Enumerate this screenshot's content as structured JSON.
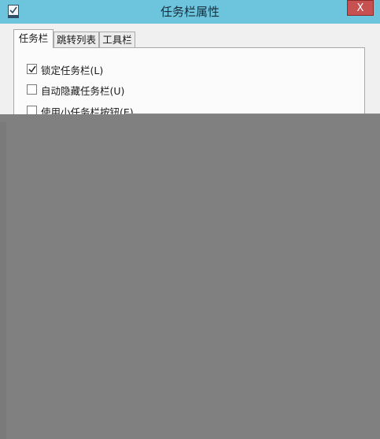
{
  "window": {
    "title": "任务栏属性",
    "close_glyph": "X"
  },
  "tabs": [
    {
      "label": "任务栏",
      "active": true
    },
    {
      "label": "跳转列表",
      "active": false
    },
    {
      "label": "工具栏",
      "active": false
    }
  ],
  "options": [
    {
      "label": "锁定任务栏(L)",
      "checked": true
    },
    {
      "label": "自动隐藏任务栏(U)",
      "checked": false
    },
    {
      "label": "使用小任务栏按钮(E)",
      "checked": false
    }
  ],
  "colors": {
    "titlebar": "#6dc4dd",
    "overlay": "#808080",
    "close": "#c75050"
  }
}
